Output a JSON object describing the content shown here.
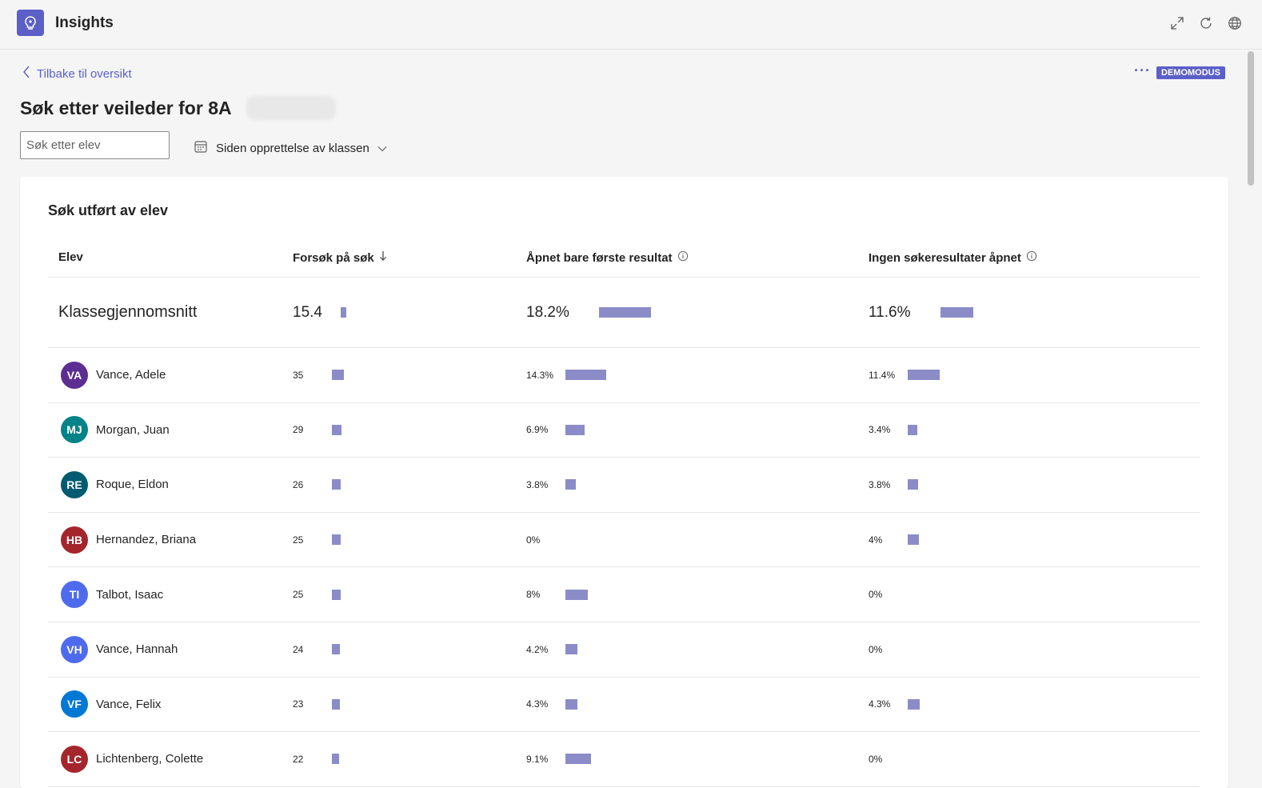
{
  "app": {
    "title": "Insights"
  },
  "header": {
    "back_label": "Tilbake til oversikt",
    "page_title": "Søk etter veileder for 8A",
    "more_label": "···",
    "demo_badge": "DEMOMODUS"
  },
  "filters": {
    "search_placeholder": "Søk etter elev",
    "date_range": "Siden opprettelse av klassen"
  },
  "card": {
    "title": "Søk utført av elev",
    "columns": [
      "Elev",
      "Forsøk på søk",
      "Åpnet bare første resultat",
      "Ingen søkeresultater åpnet"
    ],
    "average": {
      "name": "Klassegjennomsnitt",
      "attempts": "15.4",
      "first_only": "18.2%",
      "none_opened": "11.6%"
    },
    "students": [
      {
        "initials": "VA",
        "name": "Vance, Adele",
        "attempts": "35",
        "first_only": "14.3%",
        "none_opened": "11.4%",
        "color": "#5c2e91"
      },
      {
        "initials": "MJ",
        "name": "Morgan, Juan",
        "attempts": "29",
        "first_only": "6.9%",
        "none_opened": "3.4%",
        "color": "#038387"
      },
      {
        "initials": "RE",
        "name": "Roque, Eldon",
        "attempts": "26",
        "first_only": "3.8%",
        "none_opened": "3.8%",
        "color": "#005b70"
      },
      {
        "initials": "HB",
        "name": "Hernandez, Briana",
        "attempts": "25",
        "first_only": "0%",
        "none_opened": "4%",
        "color": "#a4262c"
      },
      {
        "initials": "TI",
        "name": "Talbot, Isaac",
        "attempts": "25",
        "first_only": "8%",
        "none_opened": "0%",
        "color": "#4f6bed"
      },
      {
        "initials": "VH",
        "name": "Vance, Hannah",
        "attempts": "24",
        "first_only": "4.2%",
        "none_opened": "0%",
        "color": "#4f6bed"
      },
      {
        "initials": "VF",
        "name": "Vance, Felix",
        "attempts": "23",
        "first_only": "4.3%",
        "none_opened": "4.3%",
        "color": "#0078d4"
      },
      {
        "initials": "LC",
        "name": "Lichtenberg, Colette",
        "attempts": "22",
        "first_only": "9.1%",
        "none_opened": "0%",
        "color": "#a4262c"
      }
    ]
  },
  "colors": {
    "accent": "#5b5fc7",
    "bar": "#8b8cc7"
  }
}
